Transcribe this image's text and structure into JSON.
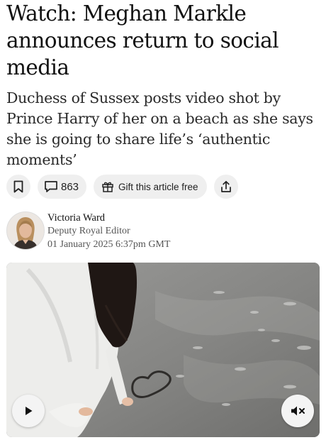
{
  "article": {
    "headline": "Watch: Meghan Markle announces return to social media",
    "standfirst": "Duchess of Sussex posts video shot by Prince Harry of her on a beach as she says she is going to share life’s ‘authentic moments’"
  },
  "actions": {
    "bookmark_icon": "bookmark-icon",
    "comments_icon": "comment-bubble-icon",
    "comments_count": "863",
    "gift_icon": "gift-icon",
    "gift_label": "Gift this article free",
    "share_icon": "share-icon"
  },
  "author": {
    "name": "Victoria Ward",
    "role": "Deputy Royal Editor",
    "date": "01 January 2025 6:37pm GMT"
  },
  "video": {
    "play_icon": "play-icon",
    "mute_icon": "mute-icon"
  },
  "colors": {
    "pill_background": "#efefef",
    "text_primary": "#111111",
    "text_secondary": "#555555"
  }
}
